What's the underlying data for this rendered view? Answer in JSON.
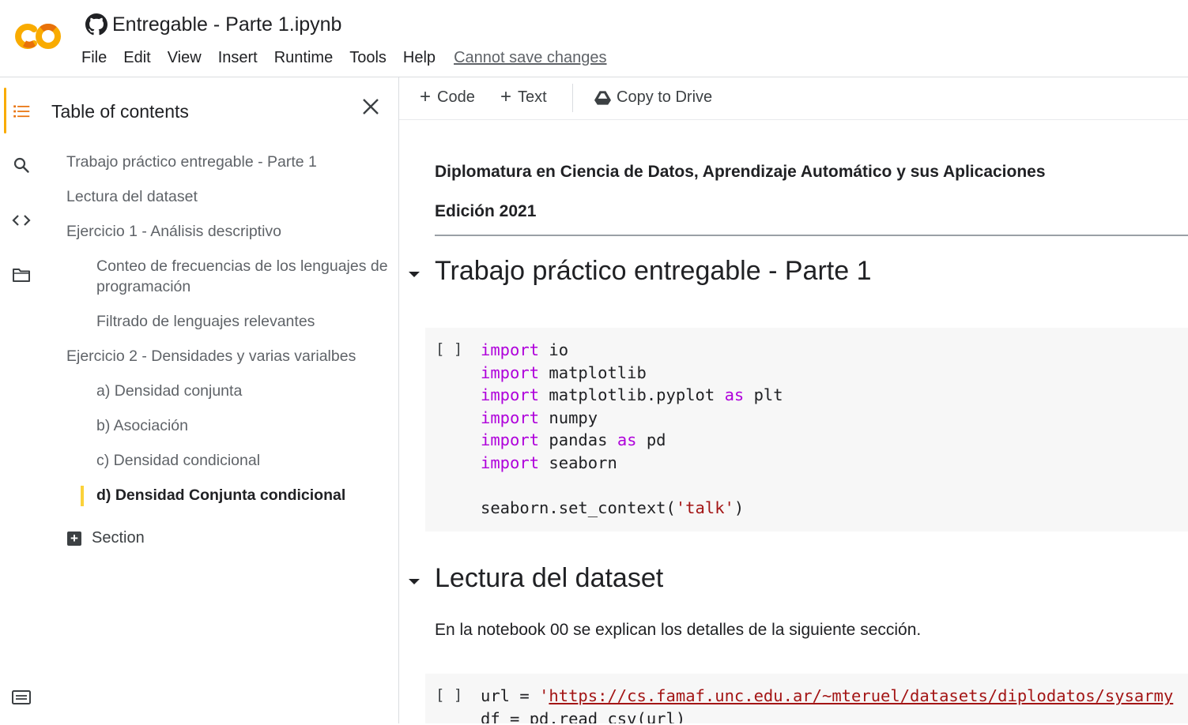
{
  "header": {
    "logo_text": "CO",
    "notebook_title": "Entregable - Parte 1.ipynb",
    "menu": [
      "File",
      "Edit",
      "View",
      "Insert",
      "Runtime",
      "Tools",
      "Help"
    ],
    "save_status": "Cannot save changes"
  },
  "rail": {
    "icons": [
      "toc-icon",
      "search-icon",
      "code-snippets-icon",
      "folder-icon",
      "terminal-icon"
    ]
  },
  "sidebar": {
    "title": "Table of contents",
    "items": [
      {
        "label": "Trabajo práctico entregable - Parte 1",
        "level": 1
      },
      {
        "label": "Lectura del dataset",
        "level": 1
      },
      {
        "label": "Ejercicio 1 - Análisis descriptivo",
        "level": 1
      },
      {
        "label": "Conteo de frecuencias de los lenguajes de programación",
        "level": 2
      },
      {
        "label": "Filtrado de lenguajes relevantes",
        "level": 2
      },
      {
        "label": "Ejercicio 2 - Densidades y varias varialbes",
        "level": 1
      },
      {
        "label": "a) Densidad conjunta",
        "level": 2
      },
      {
        "label": "b) Asociación",
        "level": 2
      },
      {
        "label": "c) Densidad condicional",
        "level": 2
      },
      {
        "label": "d) Densidad Conjunta condicional",
        "level": 2,
        "selected": true
      }
    ],
    "add_section_label": "Section"
  },
  "toolbar": {
    "code_label": "Code",
    "text_label": "Text",
    "copy_label": "Copy to Drive"
  },
  "notebook": {
    "intro_line1": "Diplomatura en Ciencia de Datos, Aprendizaje Automático y sus Aplicaciones",
    "intro_line2": "Edición 2021",
    "heading1": "Trabajo práctico entregable - Parte 1",
    "cell1_run": "[ ]",
    "heading2": "Lectura del dataset",
    "paragraph": "En la notebook 00 se explican los detalles de la siguiente sección.",
    "cell2_run": "[ ]"
  },
  "code": {
    "kw_import": "import",
    "kw_as": "as",
    "m_io": " io",
    "m_matplotlib": " matplotlib",
    "m_pyplot": " matplotlib.pyplot ",
    "a_plt": " plt",
    "m_numpy": " numpy",
    "m_pandas": " pandas ",
    "a_pd": " pd",
    "m_seaborn": " seaborn",
    "set_context_pre": "seaborn.set_context(",
    "set_context_arg": "'talk'",
    "set_context_post": ")",
    "url_pre": "url = ",
    "url_quote": "'",
    "url_value": "https://cs.famaf.unc.edu.ar/~mteruel/datasets/diplodatos/sysarmy",
    "df_line": "df = pd.read_csv(url)"
  }
}
